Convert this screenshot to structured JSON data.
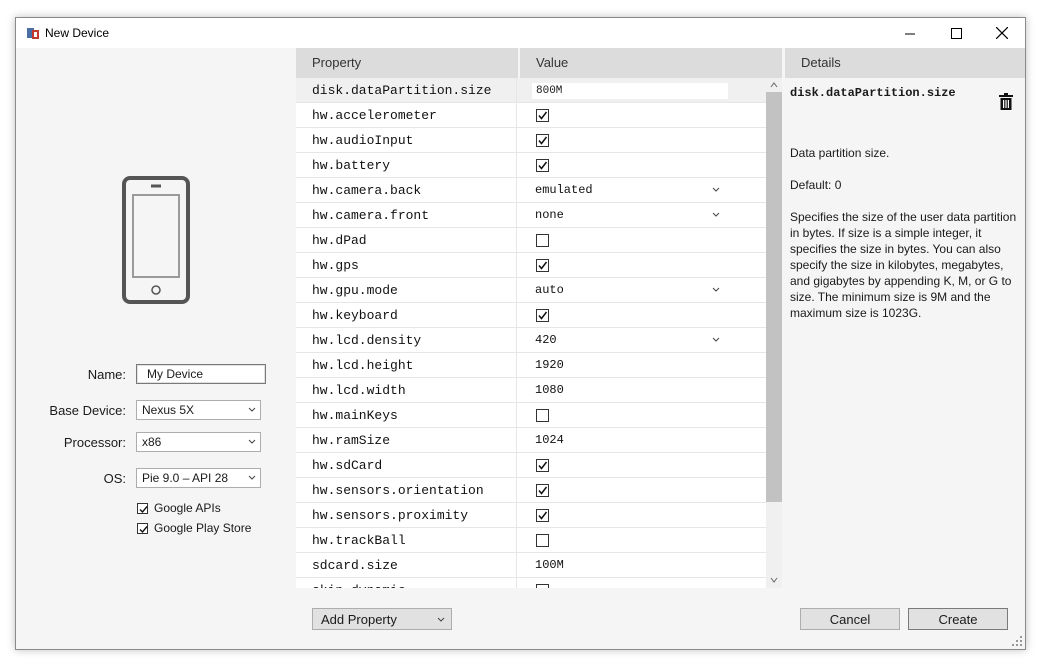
{
  "window": {
    "title": "New Device"
  },
  "left": {
    "name_label": "Name:",
    "name_value": "My Device",
    "base_label": "Base Device:",
    "base_value": "Nexus 5X",
    "proc_label": "Processor:",
    "proc_value": "x86",
    "os_label": "OS:",
    "os_value": "Pie 9.0 – API 28",
    "google_apis": {
      "label": "Google APIs",
      "checked": true
    },
    "play_store": {
      "label": "Google Play Store",
      "checked": true
    }
  },
  "grid": {
    "col_property": "Property",
    "col_value": "Value",
    "rows": [
      {
        "prop": "disk.dataPartition.size",
        "type": "text-input",
        "value": "800M"
      },
      {
        "prop": "hw.accelerometer",
        "type": "check",
        "checked": true
      },
      {
        "prop": "hw.audioInput",
        "type": "check",
        "checked": true
      },
      {
        "prop": "hw.battery",
        "type": "check",
        "checked": true
      },
      {
        "prop": "hw.camera.back",
        "type": "dropdown",
        "value": "emulated"
      },
      {
        "prop": "hw.camera.front",
        "type": "dropdown",
        "value": "none"
      },
      {
        "prop": "hw.dPad",
        "type": "check",
        "checked": false
      },
      {
        "prop": "hw.gps",
        "type": "check",
        "checked": true
      },
      {
        "prop": "hw.gpu.mode",
        "type": "dropdown",
        "value": "auto"
      },
      {
        "prop": "hw.keyboard",
        "type": "check",
        "checked": true
      },
      {
        "prop": "hw.lcd.density",
        "type": "dropdown",
        "value": "420"
      },
      {
        "prop": "hw.lcd.height",
        "type": "text",
        "value": "1920"
      },
      {
        "prop": "hw.lcd.width",
        "type": "text",
        "value": "1080"
      },
      {
        "prop": "hw.mainKeys",
        "type": "check",
        "checked": false
      },
      {
        "prop": "hw.ramSize",
        "type": "text",
        "value": "1024"
      },
      {
        "prop": "hw.sdCard",
        "type": "check",
        "checked": true
      },
      {
        "prop": "hw.sensors.orientation",
        "type": "check",
        "checked": true
      },
      {
        "prop": "hw.sensors.proximity",
        "type": "check",
        "checked": true
      },
      {
        "prop": "hw.trackBall",
        "type": "check",
        "checked": false
      },
      {
        "prop": "sdcard.size",
        "type": "text",
        "value": "100M"
      },
      {
        "prop": "skin.dynamic",
        "type": "check",
        "checked": false
      }
    ]
  },
  "details": {
    "header": "Details",
    "title": "disk.dataPartition.size",
    "summary": "Data partition size.",
    "default": "Default: 0",
    "description": "Specifies the size of the user data partition in bytes. If size is a simple integer, it specifies the size in bytes. You can also specify the size in kilobytes, megabytes, and gigabytes by appending K, M, or G to size. The minimum size is 9M and the maximum size is 1023G."
  },
  "buttons": {
    "add_property": "Add Property",
    "cancel": "Cancel",
    "create": "Create"
  },
  "colors": {
    "header_bg": "#dcdcdc",
    "window_bg": "#f5f5f5",
    "thumb": "#c2c2c2"
  }
}
